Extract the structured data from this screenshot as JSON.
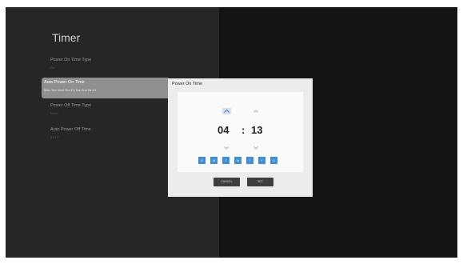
{
  "timer_page": {
    "title": "Timer",
    "items": [
      {
        "label": "Power On Time Type",
        "value": "On"
      },
      {
        "label": "Auto Power On Time",
        "value": "Mon Tue Wed Thu Fri Sat Sun 04:13"
      },
      {
        "label": "Power Off Time Type",
        "value": "None"
      },
      {
        "label": "Auto Power Off Time",
        "value": "04:17"
      }
    ],
    "selected_index": 1
  },
  "dialog": {
    "title": "Power On Time",
    "hour": "04",
    "separator": ":",
    "minute": "13",
    "days": [
      "S",
      "M",
      "T",
      "W",
      "T",
      "F",
      "S"
    ],
    "cancel_label": "CANCEL",
    "set_label": "SET"
  },
  "colors": {
    "day_chip": "#3d8fd6",
    "selected_item": "#8f8f8f",
    "button": "#3e3e3e"
  }
}
